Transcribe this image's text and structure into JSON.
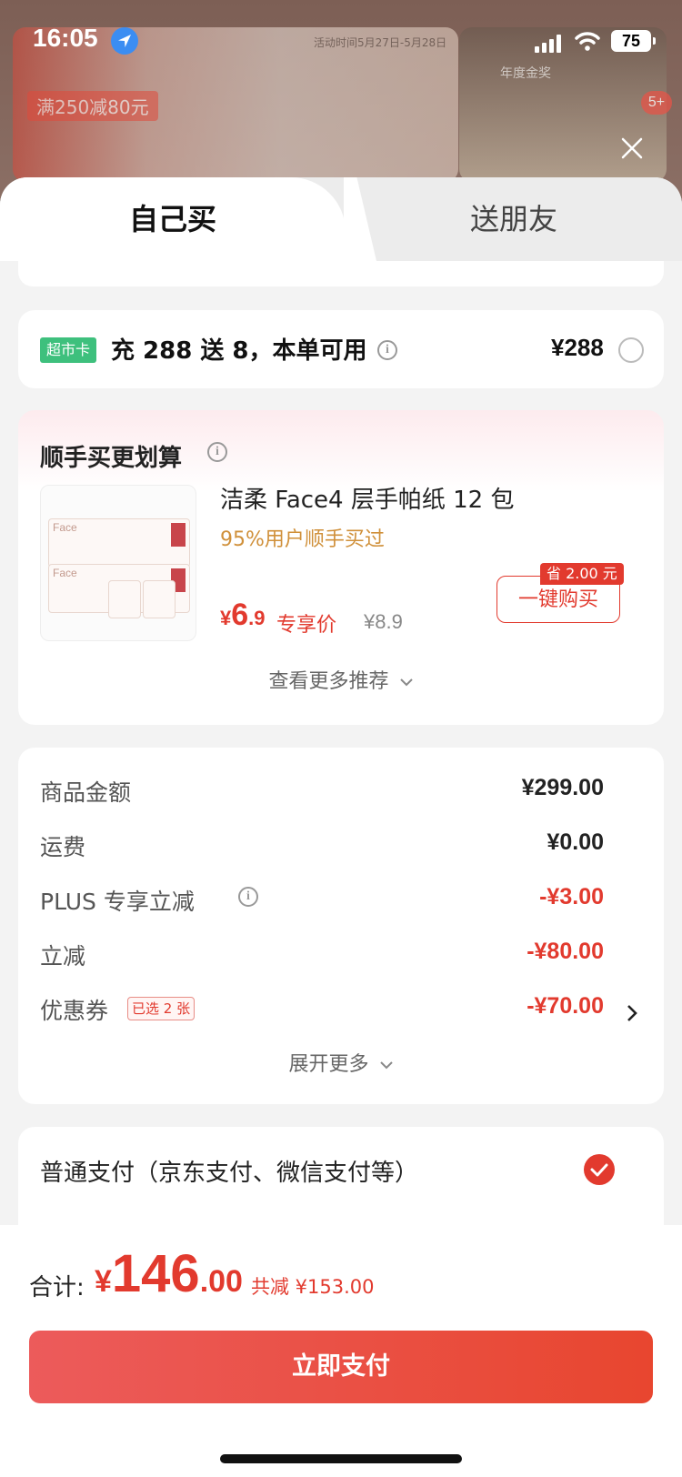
{
  "status_bar": {
    "time": "16:05",
    "battery": "75",
    "notification_badge": "5+"
  },
  "background_banner": {
    "time_range": "活动时间5月27日-5月28日",
    "promo": "满250减80元",
    "award": "年度金奖"
  },
  "tabs": [
    {
      "label": "自己买",
      "active": true
    },
    {
      "label": "送朋友",
      "active": false
    }
  ],
  "supermarket_card": {
    "tag": "超市卡",
    "text": "充 288 送 8，本单可用",
    "price": "¥288",
    "selected": false
  },
  "bundle": {
    "title": "顺手买更划算",
    "product": {
      "name": "洁柔 Face4 层手帕纸 12 包",
      "subtitle": "95%用户顺手买过",
      "price_currency": "¥",
      "price_int": "6",
      "price_dec": ".9",
      "price_note": "专享价",
      "original_price": "¥8.9",
      "save_badge": "省 2.00 元",
      "buy_button": "一键购买",
      "image_brand_text": "Face"
    },
    "more_recommendations": "查看更多推荐"
  },
  "amounts": {
    "rows": [
      {
        "label": "商品金额",
        "value": "¥299.00",
        "red": false
      },
      {
        "label": "运费",
        "value": "¥0.00",
        "red": false
      },
      {
        "label": "PLUS 专享立减",
        "value": "-¥3.00",
        "red": true
      },
      {
        "label": "立减",
        "value": "-¥80.00",
        "red": true
      },
      {
        "label": "优惠券",
        "value": "-¥70.00",
        "red": true,
        "tag": "已选 2 张"
      }
    ],
    "expand_more": "展开更多"
  },
  "payment": {
    "method": "普通支付（京东支付、微信支付等）",
    "selected": true
  },
  "footer": {
    "total_label": "合计:",
    "total_currency": "¥",
    "total_int": "146",
    "total_dec": ".00",
    "total_saved": "共减 ¥153.00",
    "pay_button": "立即支付"
  },
  "colors": {
    "accent_red": "#e23a2e",
    "tag_green": "#3ec07d",
    "location_blue": "#3b8df2"
  }
}
